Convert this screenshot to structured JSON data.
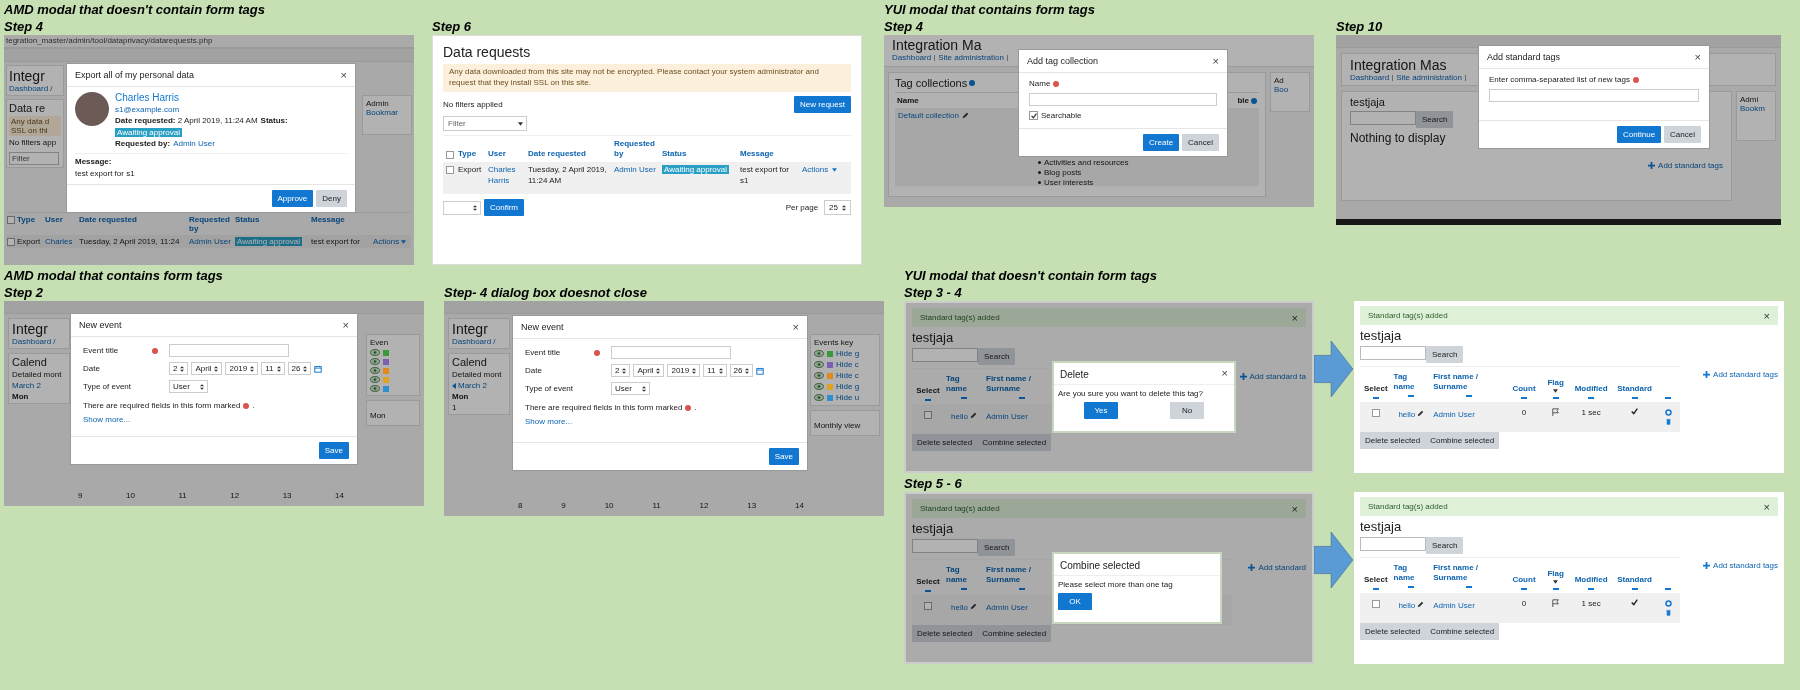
{
  "rows": [
    {
      "panels": [
        {
          "kind": "export",
          "caption": "AMD modal that doesn't contain form tags",
          "step": "Step 4",
          "url": "tegration_master/admin/tool/dataprivacy/datarequests.php",
          "page": {
            "heading": "Integr",
            "breadcrumb": "Dashboard /",
            "section": "Data re",
            "notice_lines": [
              "Any data d",
              "SSL on thi"
            ],
            "filters": "No filters app",
            "filter_placeholder": "Filter",
            "block_title": "Admin",
            "block_link": "Bookmar",
            "all_checked": false,
            "columns": [
              "Type",
              "User",
              "Date requested",
              "Requested by",
              "Status",
              "Message"
            ],
            "row": {
              "checked": false,
              "type": "Export",
              "user": "Charles",
              "date": "Tuesday, 2 April 2019, 11:24",
              "by": "Admin User",
              "status": "Awaiting approval",
              "message": "test export for",
              "actions": "Actions"
            }
          },
          "modal": {
            "title": "Export all of my personal data",
            "close": "×",
            "name": "Charles Harris",
            "email": "s1@example.com",
            "date": "**Date requested:** 2 April 2019, 11:24 AM",
            "status_label": "Status:",
            "status": "Awaiting approval",
            "by_label": "Requested by:",
            "by": "Admin User",
            "message_label": "Message:",
            "message": "test export for s1",
            "buttons": [
              {
                "label": "Approve",
                "kind": "primary"
              },
              {
                "label": "Deny",
                "kind": "secondary"
              }
            ]
          }
        },
        {
          "kind": "requests",
          "step": "Step 6",
          "title": "Data requests",
          "notice": "Any data downloaded from this site may not be encrypted. Please contact your system administrator and request that they install SSL on this site.",
          "filters": "No filters applied",
          "new_button": "New request",
          "filter_placeholder": "Filter",
          "all_checked": false,
          "columns": [
            "Type",
            "User",
            "Date requested",
            "Requested by",
            "Status",
            "Message"
          ],
          "row": {
            "checked": false,
            "type": "Export",
            "user": "Charles Harris",
            "date": "Tuesday, 2 April 2019, 11:24 AM",
            "by": "Admin User",
            "status": "Awaiting approval",
            "message": "test export for s1",
            "actions": "Actions"
          },
          "confirm": "Confirm",
          "per_page_label": "Per page",
          "per_page": "25"
        },
        {
          "kind": "tagcoll",
          "caption": "YUI modal that contains form tags",
          "step": "Step 4",
          "page": {
            "heading": "Integration Ma",
            "breadcrumb": [
              "Dashboard",
              "Site administration"
            ],
            "section": "Tag collections",
            "col_name": "Name",
            "col_cut": "ble",
            "row": "Default collection",
            "areas": [
              "Activities and resources",
              "Blog posts",
              "User interests"
            ],
            "block_title": "Ad",
            "block_link": "Boo"
          },
          "modal": {
            "title": "Add tag collection",
            "close": "×",
            "field_label": "Name",
            "checkbox_label": "Searchable",
            "checked": true,
            "buttons": [
              {
                "label": "Create",
                "kind": "primary"
              },
              {
                "label": "Cancel",
                "kind": "secondary"
              }
            ]
          }
        },
        {
          "kind": "stdtags",
          "step": "Step 10",
          "page": {
            "heading": "Integration Mas",
            "breadcrumb": [
              "Dashboard",
              "Site administration"
            ],
            "tag": "testjaja",
            "search": "Search",
            "empty": "Nothing to display",
            "add": "Add standard tags",
            "block_title": "Admi",
            "block_link": "Bookm"
          },
          "modal": {
            "title": "Add standard tags",
            "close": "×",
            "field_label": "Enter comma-separated list of new tags",
            "buttons": [
              {
                "label": "Continue",
                "kind": "primary"
              },
              {
                "label": "Cancel",
                "kind": "secondary"
              }
            ]
          }
        }
      ]
    },
    {
      "panels": [
        {
          "kind": "event",
          "caption": "AMD modal that contains form tags",
          "step": "Step 2",
          "page": {
            "heading": "Integr",
            "breadcrumb": "Dashboard /",
            "section": "Calend",
            "subtitle": "Detailed mont",
            "month": "March 2",
            "prev_icon": false,
            "day_header": "Mon",
            "days": [
              "9",
              "10",
              "11",
              "12",
              "13",
              "14"
            ],
            "side_title": "Even",
            "side_items": [
              {
                "color": "#3a9a3a"
              },
              {
                "color": "#7b5fb0"
              },
              {
                "color": "#e08a1e"
              },
              {
                "color": "#e0a31e"
              },
              {
                "color": "#2f8fd0"
              }
            ],
            "side_title2": "Mon"
          },
          "modal": {
            "title": "New event",
            "close": "×",
            "title_label": "Event title",
            "date_label": "Date",
            "date_parts": [
              "2",
              "April",
              "2019",
              "11",
              "26"
            ],
            "type_label": "Type of event",
            "type_value": "User",
            "note": "There are required fields in this form marked",
            "note_end": ".",
            "more": "Show more...",
            "save": "Save"
          }
        },
        {
          "kind": "event",
          "step": "Step- 4 dialog box doesnot close",
          "page": {
            "heading": "Integr",
            "breadcrumb": "Dashboard /",
            "section": "Calend",
            "subtitle": "Detailed mont",
            "month": "March 2",
            "prev_icon": true,
            "day_header": "Mon",
            "first_day": "1",
            "days": [
              "8",
              "9",
              "10",
              "11",
              "12",
              "13",
              "14"
            ],
            "side_title": "Events key",
            "side_items": [
              {
                "color": "#3a9a3a",
                "label": "Hide g"
              },
              {
                "color": "#7b5fb0",
                "label": "Hide c"
              },
              {
                "color": "#e08a1e",
                "label": "Hide c"
              },
              {
                "color": "#e0a31e",
                "label": "Hide g"
              },
              {
                "color": "#2f8fd0",
                "label": "Hide u"
              }
            ],
            "side_title2": "Monthly view"
          },
          "modal": {
            "title": "New event",
            "close": "×",
            "title_label": "Event title",
            "date_label": "Date",
            "date_parts": [
              "2",
              "April",
              "2019",
              "11",
              "26"
            ],
            "type_label": "Type of event",
            "type_value": "User",
            "note": "There are required fields in this form marked",
            "note_end": ".",
            "more": "Show more...",
            "save": "Save"
          }
        },
        {
          "kind": "compare",
          "caption": "YUI modal that doesn't contain form tags",
          "items": [
            {
              "step": "Step 3 - 4",
              "before": {
                "alert": "Standard tag(s) added",
                "alert_close": "×",
                "tag": "testjaja",
                "search": "Search",
                "add": "Add standard ta",
                "columns": [
                  {
                    "label": "Select",
                    "link": false
                  },
                  {
                    "label": "Tag name",
                    "link": true
                  },
                  {
                    "label": "First name / Surname",
                    "link": true
                  }
                ],
                "row": {
                  "checked": false,
                  "tag": "hello",
                  "user": "Admin User"
                },
                "buttons": [
                  "Delete selected",
                  "Combine selected"
                ],
                "modal": {
                  "title": "Delete",
                  "close": "×",
                  "text": "Are you sure you want to delete this tag?",
                  "buttons": [
                    {
                      "label": "Yes",
                      "kind": "primary"
                    },
                    {
                      "label": "No",
                      "kind": "secondary"
                    }
                  ]
                }
              },
              "after": {
                "alert": "Standard tag(s) added",
                "alert_close": "×",
                "tag": "testjaja",
                "search": "Search",
                "add": "Add standard tags",
                "columns": [
                  {
                    "label": "Select",
                    "link": false
                  },
                  {
                    "label": "Tag name",
                    "link": true
                  },
                  {
                    "label": "First name / Surname",
                    "link": true
                  },
                  {
                    "label": "Count",
                    "link": true
                  },
                  {
                    "label": "Flag",
                    "link": true
                  },
                  {
                    "label": "Modified",
                    "link": true
                  },
                  {
                    "label": "Standard",
                    "link": true
                  }
                ],
                "row": {
                  "checked": false,
                  "tag": "hello",
                  "user": "Admin User",
                  "count": "0",
                  "modified": "1 sec",
                  "standard": true
                },
                "buttons": [
                  "Delete selected",
                  "Combine selected"
                ]
              }
            },
            {
              "step": "Step 5 - 6",
              "before": {
                "alert": "Standard tag(s) added",
                "alert_close": "×",
                "tag": "testjaja",
                "search": "Search",
                "add": "Add standard",
                "columns": [
                  {
                    "label": "Select",
                    "link": false
                  },
                  {
                    "label": "Tag name",
                    "link": true
                  },
                  {
                    "label": "First name / Surname",
                    "link": true
                  }
                ],
                "row": {
                  "checked": false,
                  "tag": "hello",
                  "user": "Admin User"
                },
                "buttons": [
                  "Delete selected",
                  "Combine selected"
                ],
                "modal": {
                  "title": "Combine selected",
                  "text": "Please select more than one tag",
                  "buttons": [
                    {
                      "label": "OK",
                      "kind": "primary"
                    }
                  ]
                }
              },
              "after": {
                "alert": "Standard tag(s) added",
                "alert_close": "×",
                "tag": "testjaja",
                "search": "Search",
                "add": "Add standard tags",
                "columns": [
                  {
                    "label": "Select",
                    "link": false
                  },
                  {
                    "label": "Tag name",
                    "link": true
                  },
                  {
                    "label": "First name / Surname",
                    "link": true
                  },
                  {
                    "label": "Count",
                    "link": true
                  },
                  {
                    "label": "Flag",
                    "link": true
                  },
                  {
                    "label": "Modified",
                    "link": true
                  },
                  {
                    "label": "Standard",
                    "link": true
                  }
                ],
                "row": {
                  "checked": false,
                  "tag": "hello",
                  "user": "Admin User",
                  "count": "0",
                  "modified": "1 sec",
                  "standard": true
                },
                "buttons": [
                  "Delete selected",
                  "Combine selected"
                ]
              }
            }
          ]
        }
      ]
    }
  ]
}
